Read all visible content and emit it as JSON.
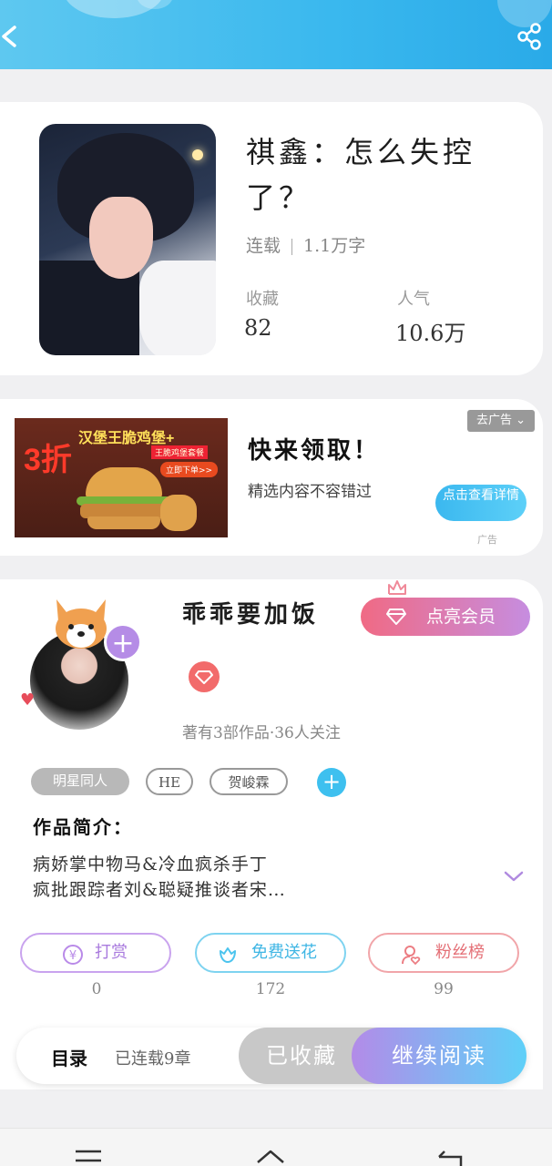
{
  "header": {
    "back_icon": "chevron-left-icon",
    "share_icon": "share-icon"
  },
  "book": {
    "title": "祺鑫：怎么失控了？",
    "status": "连载",
    "word_count": "1.1万字",
    "favorites_label": "收藏",
    "favorites_value": "82",
    "popularity_label": "人气",
    "popularity_value": "10.6万"
  },
  "ad": {
    "image_promo": "3折",
    "image_product": "汉堡王脆鸡堡+",
    "image_sub": "王脆鸡堡套餐",
    "image_cta": "立即下单>>",
    "title": "快来领取！",
    "description": "精选内容不容错过",
    "tag": "去广告 ⌄",
    "button": "点击查看详情",
    "label": "广告"
  },
  "author": {
    "name": "乖乖要加饭",
    "vip_button": "点亮会员",
    "meta": "著有3部作品·36人关注",
    "avatar_plus": "+"
  },
  "tags": [
    "明星同人",
    "HE",
    "贺峻霖"
  ],
  "tag_add": "+",
  "intro": {
    "title": "作品简介：",
    "line1": "病娇掌中物马&冷血疯杀手丁",
    "line2": "疯批跟踪者刘&聪疑推谈者宋…"
  },
  "actions": [
    {
      "label": "打赏",
      "count": "0",
      "color": "#b98ae8"
    },
    {
      "label": "免费送花",
      "count": "172",
      "color": "#4cc4ee"
    },
    {
      "label": "粉丝榜",
      "count": "99",
      "color": "#ec7d83"
    }
  ],
  "reading_bar": {
    "toc_label": "目录",
    "toc_info": "已连载9章",
    "favorited": "已收藏",
    "continue": "继续阅读"
  },
  "colors": {
    "accent_blue": "#3ab8ee",
    "vip_pink": "#f06a84",
    "purple": "#b58ce6"
  }
}
